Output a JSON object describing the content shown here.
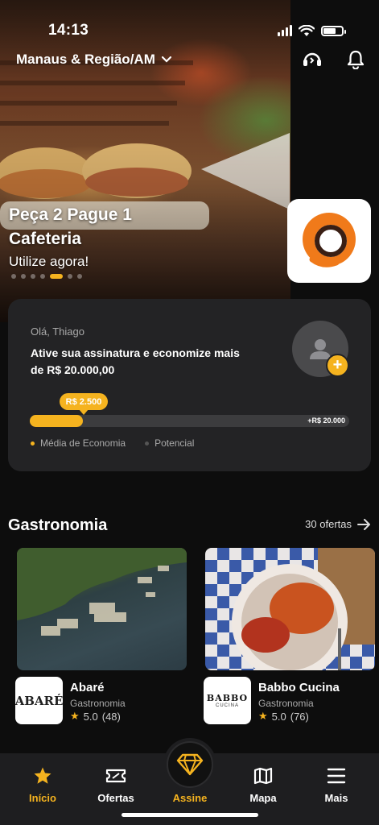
{
  "status_bar": {
    "time": "14:13"
  },
  "header": {
    "location": "Manaus & Região/AM"
  },
  "hero": {
    "title": "Peça 2 Pague 1 Cafeteria",
    "subtitle": "Utilize agora!",
    "slide_count": 7,
    "active_slide": 5
  },
  "savings_card": {
    "greeting": "Olá, Thiago",
    "message": "Ative sua assinatura e economize mais de  R$ 20.000,00",
    "current_value_label": "R$ 2.500",
    "max_value_label": "+R$ 20.000",
    "progress_fraction": 0.165,
    "legend": [
      {
        "label": "Média de Economia",
        "color": "#f5b31f"
      },
      {
        "label": "Potencial",
        "color": "#555555"
      }
    ]
  },
  "section": {
    "title": "Gastronomia",
    "link_label": "30 ofertas"
  },
  "offers": [
    {
      "name": "Abaré",
      "category": "Gastronomia",
      "rating": "5.0",
      "reviews": "(48)",
      "logo_text": "ABARÉ"
    },
    {
      "name": "Babbo Cucina",
      "category": "Gastronomia",
      "rating": "5.0",
      "reviews": "(76)",
      "logo_text": "BABBO",
      "logo_sub": "CUCINA"
    }
  ],
  "bottom_nav": [
    {
      "label": "Início",
      "icon": "star-icon",
      "active": true
    },
    {
      "label": "Ofertas",
      "icon": "ticket-icon",
      "active": false
    },
    {
      "label": "Assine",
      "icon": "diamond-icon",
      "active": true
    },
    {
      "label": "Mapa",
      "icon": "map-icon",
      "active": false
    },
    {
      "label": "Mais",
      "icon": "menu-icon",
      "active": false
    }
  ],
  "colors": {
    "accent": "#f5b31f",
    "background": "#0d0d0d",
    "card": "#232325"
  }
}
